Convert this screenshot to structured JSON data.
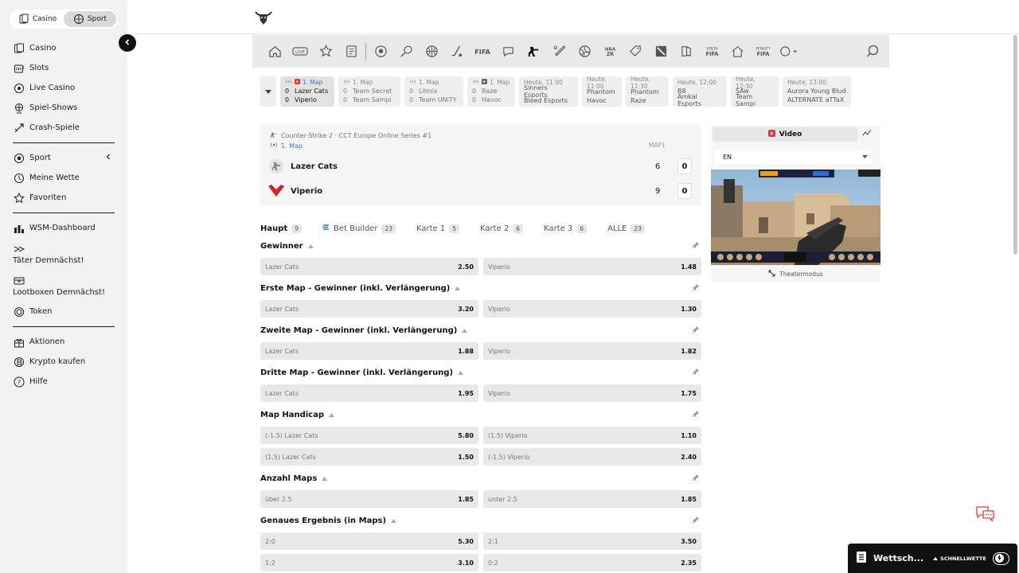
{
  "mode_switch": {
    "casino": "Casino",
    "sport": "Sport"
  },
  "sidebar": {
    "group1": [
      {
        "label": "Casino",
        "icon": "casino-icon"
      },
      {
        "label": "Slots",
        "icon": "slots-icon"
      },
      {
        "label": "Live Casino",
        "icon": "live-casino-icon"
      },
      {
        "label": "Spiel-Shows",
        "icon": "game-shows-icon"
      },
      {
        "label": "Crash-Spiele",
        "icon": "crash-games-icon"
      }
    ],
    "group2": [
      {
        "label": "Sport",
        "icon": "sport-icon"
      },
      {
        "label": "Meine Wette",
        "icon": "my-bets-icon"
      },
      {
        "label": "Favoriten",
        "icon": "star-icon"
      }
    ],
    "group3": [
      {
        "label": "WSM-Dashboard",
        "icon": "dashboard-icon"
      },
      {
        "label": "Täter Demnächst!",
        "icon": "arrows-icon"
      },
      {
        "label": "Lootboxen Demnächst!",
        "icon": "lootbox-icon"
      },
      {
        "label": "Token",
        "icon": "token-icon"
      }
    ],
    "group4": [
      {
        "label": "Aktionen",
        "icon": "gift-icon"
      },
      {
        "label": "Krypto kaufen",
        "icon": "crypto-icon"
      },
      {
        "label": "Hilfe",
        "icon": "help-icon"
      }
    ]
  },
  "strip": {
    "cards": [
      {
        "head": "1. Map",
        "live": true,
        "s1": "0",
        "t1": "Lazer Cats",
        "s2": "0",
        "t2": "Viperio"
      },
      {
        "head": "1. Map",
        "live": true,
        "s1": "0",
        "t1": "Team Secret",
        "s2": "0",
        "t2": "Team Sampi"
      },
      {
        "head": "1. Map",
        "live": true,
        "s1": "0",
        "t1": "Lilmix",
        "s2": "0",
        "t2": "Team UNiTY"
      },
      {
        "head": "1. Map",
        "live": true,
        "s1": "0",
        "t1": "Raze",
        "s2": "0",
        "t2": "Havoc"
      },
      {
        "head": "Heute, 11:00",
        "live": false,
        "t1": "Sinners Esports",
        "t2": "Bleed Esports"
      },
      {
        "head": "Heute, 11:00",
        "live": false,
        "t1": "Phantom",
        "t2": "Havoc"
      },
      {
        "head": "Heute, 11:30",
        "live": false,
        "t1": "Phantom",
        "t2": "Raze"
      },
      {
        "head": "Heute, 12:00",
        "live": false,
        "t1": "B8",
        "t2": "Amkal Esports"
      },
      {
        "head": "Heute, 12:30",
        "live": false,
        "t1": "SAw",
        "t2": "Team Sampi"
      },
      {
        "head": "Heute, 13:00",
        "live": false,
        "t1": "Aurora Young Blud",
        "t2": "ALTERNATE aTTaX"
      }
    ]
  },
  "scoreboard": {
    "league": "Counter-Strike 2 · CCT Europe Online Series #1",
    "live_label": "1. Map",
    "map_header": "MAP1",
    "team1": {
      "name": "Lazer Cats",
      "map": "6",
      "total": "0"
    },
    "team2": {
      "name": "Viperio",
      "map": "9",
      "total": "0"
    }
  },
  "tabs": [
    {
      "label": "Haupt",
      "count": "9",
      "active": true
    },
    {
      "label": "Bet Builder",
      "count": "23",
      "active": false
    },
    {
      "label": "Karte 1",
      "count": "5",
      "active": false
    },
    {
      "label": "Karte 2",
      "count": "6",
      "active": false
    },
    {
      "label": "Karte 3",
      "count": "6",
      "active": false
    },
    {
      "label": "ALLE",
      "count": "23",
      "active": false
    }
  ],
  "markets": [
    {
      "title": "Gewinner",
      "rows": [
        [
          {
            "l": "Lazer Cats",
            "v": "2.50"
          },
          {
            "l": "Viperio",
            "v": "1.48"
          }
        ]
      ]
    },
    {
      "title": "Erste Map - Gewinner (inkl. Verlängerung)",
      "rows": [
        [
          {
            "l": "Lazer Cats",
            "v": "3.20"
          },
          {
            "l": "Viperio",
            "v": "1.30"
          }
        ]
      ]
    },
    {
      "title": "Zweite Map - Gewinner (inkl. Verlängerung)",
      "rows": [
        [
          {
            "l": "Lazer Cats",
            "v": "1.88"
          },
          {
            "l": "Viperio",
            "v": "1.82"
          }
        ]
      ]
    },
    {
      "title": "Dritte Map - Gewinner (inkl. Verlängerung)",
      "rows": [
        [
          {
            "l": "Lazer Cats",
            "v": "1.95"
          },
          {
            "l": "Viperio",
            "v": "1.75"
          }
        ]
      ]
    },
    {
      "title": "Map Handicap",
      "rows": [
        [
          {
            "l": "(-1.5) Lazer Cats",
            "v": "5.80"
          },
          {
            "l": "(1.5) Viperio",
            "v": "1.10"
          }
        ],
        [
          {
            "l": "(1.5) Lazer Cats",
            "v": "1.50"
          },
          {
            "l": "(-1.5) Viperio",
            "v": "2.40"
          }
        ]
      ]
    },
    {
      "title": "Anzahl Maps",
      "rows": [
        [
          {
            "l": "über 2.5",
            "v": "1.85"
          },
          {
            "l": "unter 2.5",
            "v": "1.85"
          }
        ]
      ]
    },
    {
      "title": "Genaues Ergebnis (in Maps)",
      "rows": [
        [
          {
            "l": "2:0",
            "v": "5.30"
          },
          {
            "l": "2:1",
            "v": "3.50"
          }
        ],
        [
          {
            "l": "1:2",
            "v": "3.10"
          },
          {
            "l": "0:2",
            "v": "2.35"
          }
        ]
      ]
    }
  ],
  "video": {
    "label": "Video",
    "language": "EN",
    "theater": "Theatermodus"
  },
  "betslip": {
    "title": "Wettsch...",
    "quick": "SCHNELLWETTE"
  },
  "colors": {
    "accent": "#4b6fd6",
    "live_red": "#e5393c",
    "viperio_red": "#d6202d"
  }
}
